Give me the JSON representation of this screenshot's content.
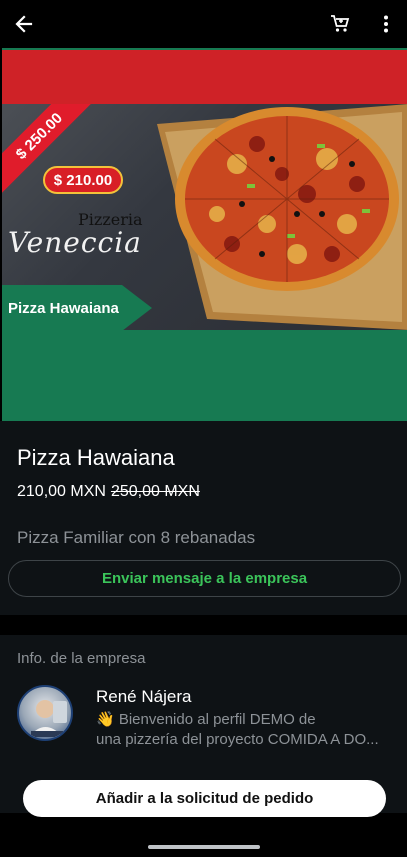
{
  "topbar": {
    "back_icon": "arrow-left-icon",
    "cart_icon": "shopping-cart-icon",
    "more_icon": "more-vertical-icon"
  },
  "banner": {
    "original_price_ribbon": "$ 250.00",
    "sale_price_pill": "$ 210.00",
    "brand_top": "Pizzeria",
    "brand_script": "Veneccia",
    "product_flag": "Pizza Hawaiana",
    "colors": {
      "red": "#cf2227",
      "green": "#177a52"
    }
  },
  "product": {
    "title": "Pizza Hawaiana",
    "price": "210,00 MXN",
    "old_price": "250,00 MXN",
    "description": "Pizza Familiar con 8 rebanadas",
    "message_button": "Enviar mensaje a la empresa",
    "accent_color": "#3bc45a"
  },
  "company_info": {
    "header": "Info. de la empresa",
    "name": "René Nájera",
    "bio_line1": "👋 Bienvenido al perfil DEMO de",
    "bio_line2": "una pizzería del proyecto COMIDA A DO..."
  },
  "footer": {
    "add_button": "Añadir a la solicitud de pedido"
  }
}
